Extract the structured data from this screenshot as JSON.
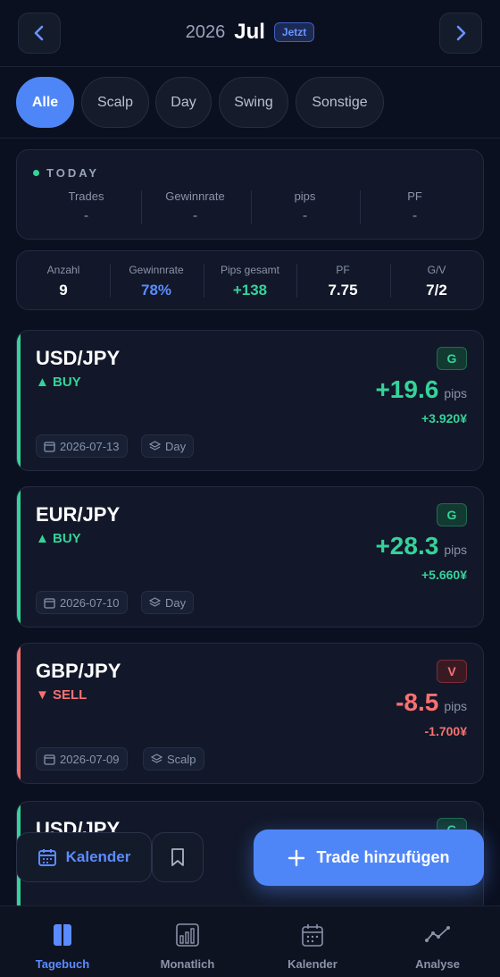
{
  "header": {
    "year": "2026",
    "month": "Jul",
    "now_label": "Jetzt"
  },
  "filters": [
    {
      "label": "Alle",
      "active": true
    },
    {
      "label": "Scalp",
      "active": false
    },
    {
      "label": "Day",
      "active": false
    },
    {
      "label": "Swing",
      "active": false
    },
    {
      "label": "Sonstige",
      "active": false
    }
  ],
  "today": {
    "title": "TODAY",
    "stats": [
      {
        "label": "Trades",
        "value": "-"
      },
      {
        "label": "Gewinnrate",
        "value": "-"
      },
      {
        "label": "pips",
        "value": "-"
      },
      {
        "label": "PF",
        "value": "-"
      }
    ]
  },
  "summary": [
    {
      "label": "Anzahl",
      "value": "9"
    },
    {
      "label": "Gewinnrate",
      "value": "78%"
    },
    {
      "label": "Pips gesamt",
      "value": "+138"
    },
    {
      "label": "PF",
      "value": "7.75"
    },
    {
      "label": "G/V",
      "value": "7/2"
    }
  ],
  "trades": [
    {
      "pair": "USD/JPY",
      "direction": "▲ BUY",
      "badge": "G",
      "pips": "+19.6",
      "pips_unit": "pips",
      "yen": "+3.920¥",
      "date": "2026-07-13",
      "style": "Day",
      "result": "win"
    },
    {
      "pair": "EUR/JPY",
      "direction": "▲ BUY",
      "badge": "G",
      "pips": "+28.3",
      "pips_unit": "pips",
      "yen": "+5.660¥",
      "date": "2026-07-10",
      "style": "Day",
      "result": "win"
    },
    {
      "pair": "GBP/JPY",
      "direction": "▼ SELL",
      "badge": "V",
      "pips": "-8.5",
      "pips_unit": "pips",
      "yen": "-1.700¥",
      "date": "2026-07-09",
      "style": "Scalp",
      "result": "loss"
    }
  ],
  "peek_trade": {
    "pair": "USD/JPY",
    "badge": "G"
  },
  "actions": {
    "calendar_label": "Kalender",
    "add_trade_label": "Trade hinzufügen"
  },
  "tabbar": [
    {
      "label": "Tagebuch",
      "icon": "journal-icon",
      "active": true
    },
    {
      "label": "Monatlich",
      "icon": "bar-chart-icon",
      "active": false
    },
    {
      "label": "Kalender",
      "icon": "calendar-icon",
      "active": false
    },
    {
      "label": "Analyse",
      "icon": "trend-line-icon",
      "active": false
    }
  ],
  "colors": {
    "accent": "#4f86f7",
    "win": "#34d399",
    "loss": "#f87171",
    "background": "#0b1020"
  }
}
